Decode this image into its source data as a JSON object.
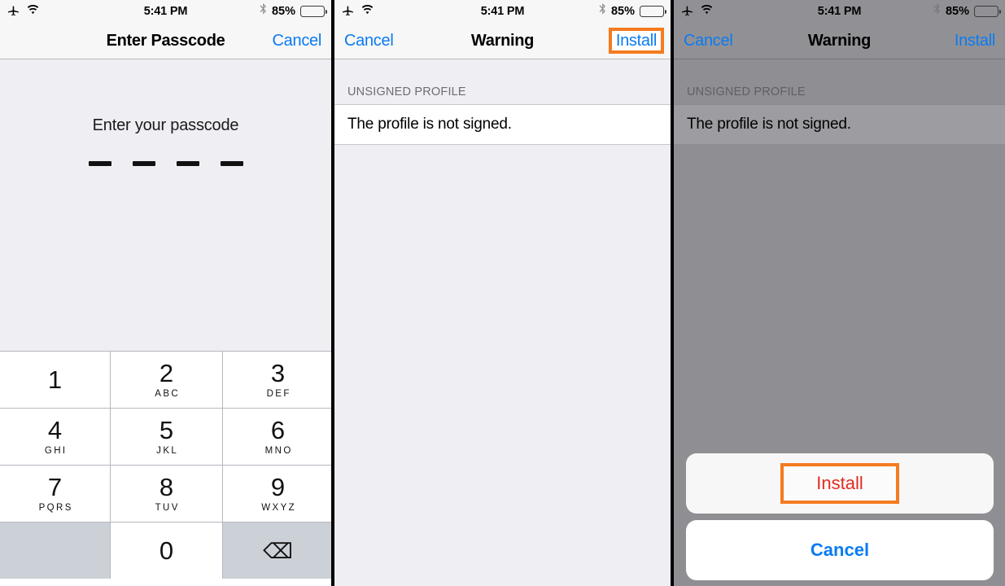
{
  "statusbar": {
    "airplane_icon": "airplane-icon",
    "wifi_icon": "wifi-icon",
    "time": "5:41 PM",
    "bluetooth_icon": "bluetooth-icon",
    "battery_percent": "85%",
    "battery_level": 85,
    "battery_color": "#ffcc00"
  },
  "colors": {
    "tint_blue": "#0a7bf3",
    "destructive_red": "#e32b20",
    "highlight_orange": "#f47b20",
    "dim_overlay": "#8e8e93",
    "screen_bg": "#efeef3"
  },
  "panel1": {
    "nav": {
      "title": "Enter Passcode",
      "right_button": "Cancel"
    },
    "prompt": "Enter your passcode",
    "passcode_slots": 4,
    "keypad": [
      {
        "num": "1",
        "letters": ""
      },
      {
        "num": "2",
        "letters": "ABC"
      },
      {
        "num": "3",
        "letters": "DEF"
      },
      {
        "num": "4",
        "letters": "GHI"
      },
      {
        "num": "5",
        "letters": "JKL"
      },
      {
        "num": "6",
        "letters": "MNO"
      },
      {
        "num": "7",
        "letters": "PQRS"
      },
      {
        "num": "8",
        "letters": "TUV"
      },
      {
        "num": "9",
        "letters": "WXYZ"
      },
      {
        "num": "0",
        "letters": ""
      }
    ],
    "delete_glyph": "⌫"
  },
  "panel2": {
    "nav": {
      "left_button": "Cancel",
      "title": "Warning",
      "right_button": "Install"
    },
    "section_header": "UNSIGNED PROFILE",
    "cell_text": "The profile is not signed."
  },
  "panel3": {
    "nav": {
      "left_button": "Cancel",
      "title": "Warning",
      "right_button": "Install"
    },
    "section_header": "UNSIGNED PROFILE",
    "cell_text": "The profile is not signed.",
    "action_sheet": {
      "install_label": "Install",
      "cancel_label": "Cancel"
    }
  }
}
